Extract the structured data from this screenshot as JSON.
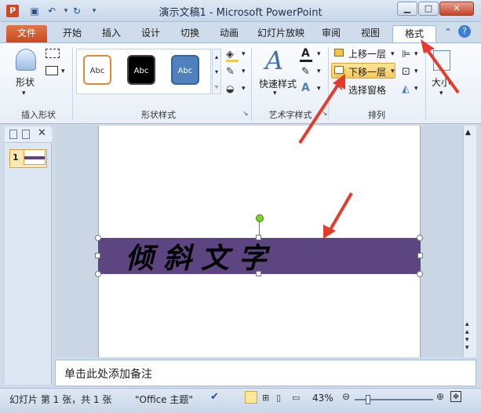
{
  "window": {
    "title": "演示文稿1 - Microsoft PowerPoint",
    "minimize": "▁",
    "maximize": "□",
    "close": "✕"
  },
  "tabs": [
    "文件",
    "开始",
    "插入",
    "设计",
    "切换",
    "动画",
    "幻灯片放映",
    "审阅",
    "视图",
    "格式"
  ],
  "ribbon": {
    "insert_shapes": {
      "shapes_label": "形状",
      "group_label": "插入形状"
    },
    "shape_styles": {
      "styles": [
        "Abc",
        "Abc",
        "Abc"
      ],
      "group_label": "形状样式"
    },
    "wordart": {
      "quick_styles_label": "快速样式",
      "group_label": "艺术字样式"
    },
    "arrange": {
      "bring_forward": "上移一层",
      "send_backward": "下移一层",
      "selection_pane": "选择窗格",
      "group_label": "排列"
    },
    "size_label": "大小"
  },
  "slides_pane": {
    "slide_number": "1"
  },
  "slide": {
    "textbox_text": "倾斜文字"
  },
  "notes": {
    "placeholder": "单击此处添加备注"
  },
  "status": {
    "slide_info": "幻灯片 第 1 张，共 1 张",
    "theme": "\"Office 主题\"",
    "zoom": "43%"
  },
  "colors": {
    "textbox_fill": "#5c4581",
    "file_tab": "#d0572b",
    "annotation_arrow": "#e43c2c"
  }
}
